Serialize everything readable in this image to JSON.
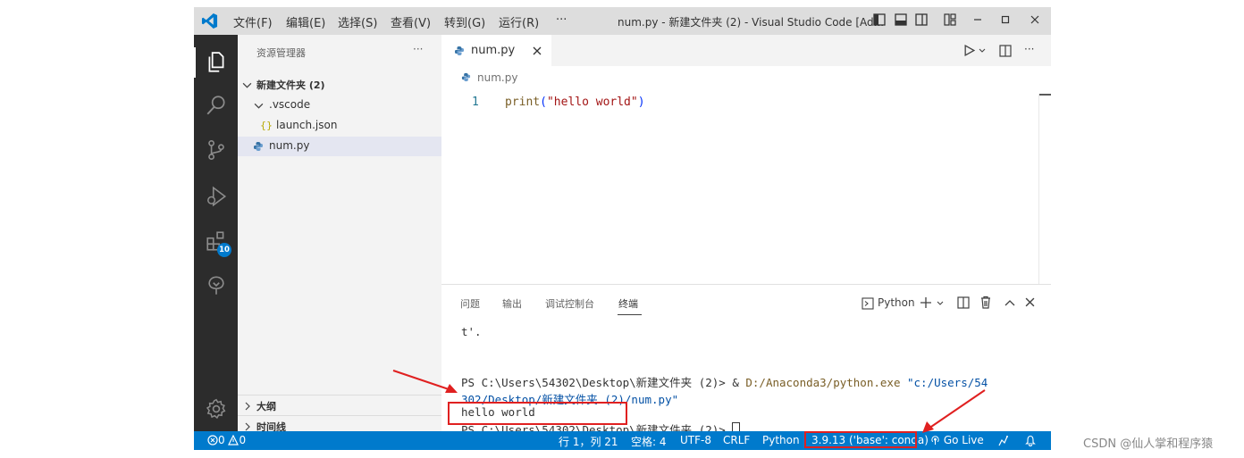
{
  "window": {
    "title": "num.py - 新建文件夹 (2) - Visual Studio Code [Ad...",
    "menu": [
      "文件(F)",
      "编辑(E)",
      "选择(S)",
      "查看(V)",
      "转到(G)",
      "运行(R)",
      "···"
    ]
  },
  "activity": {
    "extensions_badge": "10"
  },
  "sidebar": {
    "title": "资源管理器",
    "more": "···",
    "folder": "新建文件夹 (2)",
    "items": [
      {
        "label": ".vscode",
        "icon": "chevron-down-icon"
      },
      {
        "label": "launch.json",
        "icon_text": "{}"
      },
      {
        "label": "num.py",
        "icon": "python-icon"
      }
    ],
    "outline": "大纲",
    "timeline": "时间线"
  },
  "editor": {
    "tab_label": "num.py",
    "breadcrumb": "num.py",
    "lines": [
      {
        "num": "1",
        "fn": "print",
        "open": "(",
        "str": "\"hello world\"",
        "close": ")"
      }
    ]
  },
  "panel": {
    "tabs": [
      "问题",
      "输出",
      "调试控制台",
      "终端"
    ],
    "active_tab": "终端",
    "shell": "Python",
    "terminal": {
      "line1": "t'.",
      "prompt_prefix": "PS C:\\Users\\54302\\Desktop\\新建文件夹 (2)> & ",
      "cmd_exe": "D:/Anaconda3/python.exe",
      "cmd_arg_1": " \"c:/Users/54",
      "cmd_arg_2": "302/Desktop/新建文件夹 (2)/num.py\"",
      "output": "hello world",
      "prompt_end": "PS C:\\Users\\54302\\Desktop\\新建文件夹 (2)> "
    }
  },
  "status": {
    "errors": "0",
    "warnings": "0",
    "position": "行 1，列 21",
    "spaces": "空格: 4",
    "encoding": "UTF-8",
    "eol": "CRLF",
    "language": "Python",
    "interpreter": "3.9.13 ('base': conda)",
    "golive": "Go Live"
  },
  "watermark": "CSDN @仙人掌和程序猿",
  "colors": {
    "accent": "#007acc",
    "annotation": "#e02020",
    "string": "#a31515",
    "function": "#795e26"
  }
}
